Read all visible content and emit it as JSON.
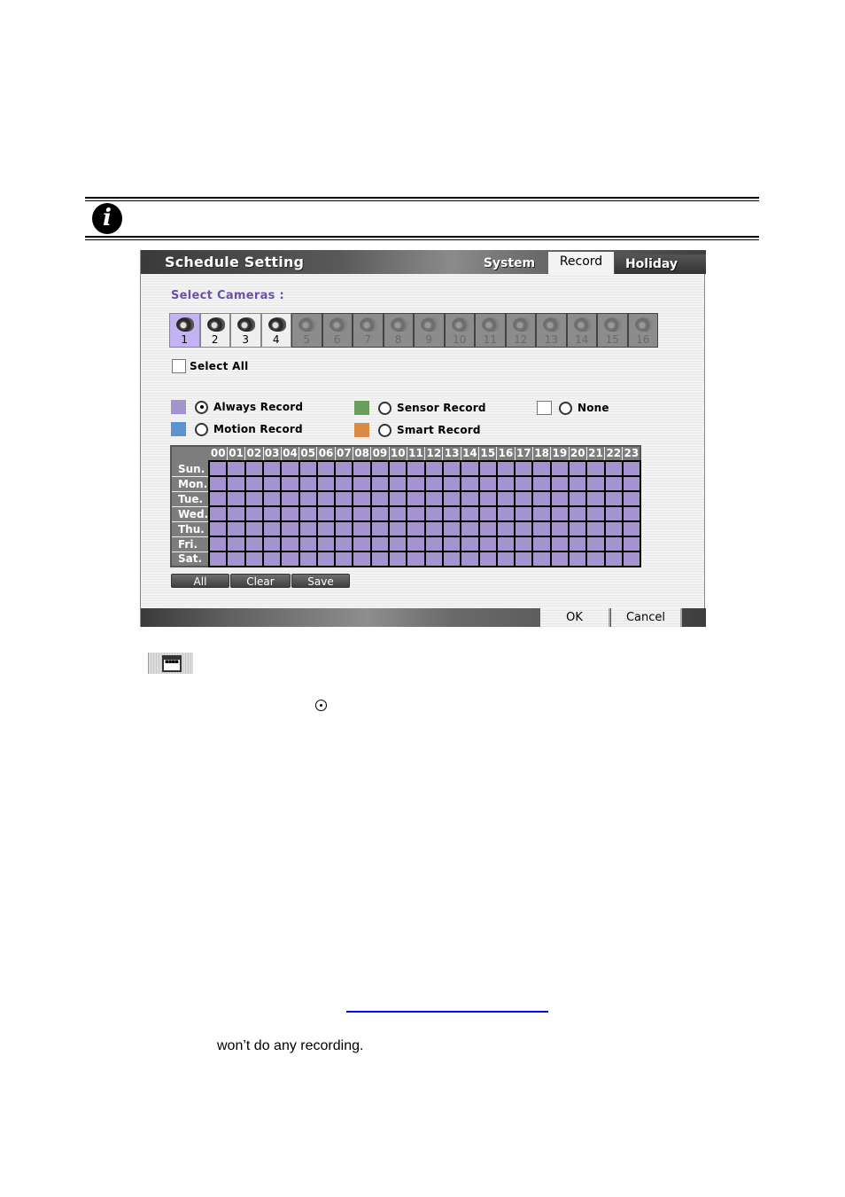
{
  "note": {
    "icon": "info-icon",
    "icon_glyph": "i"
  },
  "window": {
    "title": "Schedule Setting",
    "tabs": [
      {
        "label": "System",
        "active": false
      },
      {
        "label": "Record",
        "active": true
      },
      {
        "label": "Holiday",
        "active": false
      }
    ],
    "select_cameras_label": "Select Cameras :",
    "cameras": [
      {
        "number": "1",
        "state": "selected"
      },
      {
        "number": "2",
        "state": "enabled"
      },
      {
        "number": "3",
        "state": "enabled"
      },
      {
        "number": "4",
        "state": "enabled"
      },
      {
        "number": "5",
        "state": "disabled"
      },
      {
        "number": "6",
        "state": "disabled"
      },
      {
        "number": "7",
        "state": "disabled"
      },
      {
        "number": "8",
        "state": "disabled"
      },
      {
        "number": "9",
        "state": "disabled"
      },
      {
        "number": "10",
        "state": "disabled"
      },
      {
        "number": "11",
        "state": "disabled"
      },
      {
        "number": "12",
        "state": "disabled"
      },
      {
        "number": "13",
        "state": "disabled"
      },
      {
        "number": "14",
        "state": "disabled"
      },
      {
        "number": "15",
        "state": "disabled"
      },
      {
        "number": "16",
        "state": "disabled"
      }
    ],
    "select_all": {
      "label": "Select All",
      "checked": false
    },
    "record_modes": [
      {
        "label": "Always Record",
        "color": "#a393cf",
        "selected": true
      },
      {
        "label": "Motion Record",
        "color": "#5b93d2",
        "selected": false
      },
      {
        "label": "Sensor Record",
        "color": "#6b9e5d",
        "selected": false
      },
      {
        "label": "Smart Record",
        "color": "#d98a45",
        "selected": false
      },
      {
        "label": "None",
        "color": "#ffffff",
        "selected": false
      }
    ],
    "schedule": {
      "hours": [
        "00",
        "01",
        "02",
        "03",
        "04",
        "05",
        "06",
        "07",
        "08",
        "09",
        "10",
        "11",
        "12",
        "13",
        "14",
        "15",
        "16",
        "17",
        "18",
        "19",
        "20",
        "21",
        "22",
        "23"
      ],
      "days": [
        "Sun.",
        "Mon.",
        "Tue.",
        "Wed.",
        "Thu.",
        "Fri.",
        "Sat."
      ],
      "fill_mode": "Always Record",
      "fill_color": "#a393cf"
    },
    "grid_buttons": {
      "all": "All",
      "clear": "Clear",
      "save": "Save"
    },
    "footer_buttons": {
      "ok": "OK",
      "cancel": "Cancel"
    }
  },
  "below": {
    "schedule_icon": "calendar-icon",
    "radio_glyph": "radio-selected-icon",
    "body_text": "won’t do any recording."
  }
}
